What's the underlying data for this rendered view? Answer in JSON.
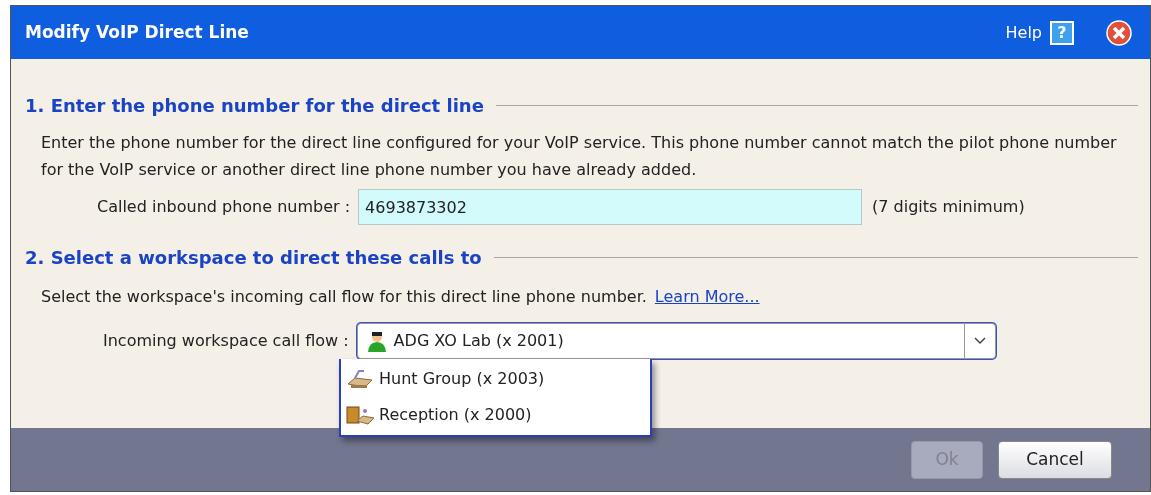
{
  "window": {
    "title": "Modify VoIP Direct Line",
    "help": "Help",
    "help_icon": "?"
  },
  "section_1": {
    "heading": "1. Enter the phone number for the direct line",
    "description": "Enter the phone number for the direct line configured for your VoIP service.  This phone number cannot match the pilot phone number for the VoIP service or another direct line phone number you have already added.",
    "field_label": "Called inbound phone number :",
    "field_value": "4693873302",
    "hint": "(7 digits minimum)"
  },
  "section_2": {
    "heading": "2. Select a workspace to direct these calls to",
    "description": "Select the workspace's incoming call flow for this direct line phone number.",
    "link": "Learn More...",
    "field_label": "Incoming workspace call flow :",
    "selected_value": {
      "label": "ADG XO Lab (x 2001)",
      "kind": "user"
    },
    "expanded": true,
    "options": [
      {
        "label": "Hunt Group (x 2003)",
        "kind": "hunt"
      },
      {
        "label": "Reception (x 2000)",
        "kind": "reception"
      }
    ]
  },
  "buttons": [
    {
      "label": "Ok",
      "disabled": true
    },
    {
      "label": "Cancel",
      "disabled": false
    }
  ]
}
